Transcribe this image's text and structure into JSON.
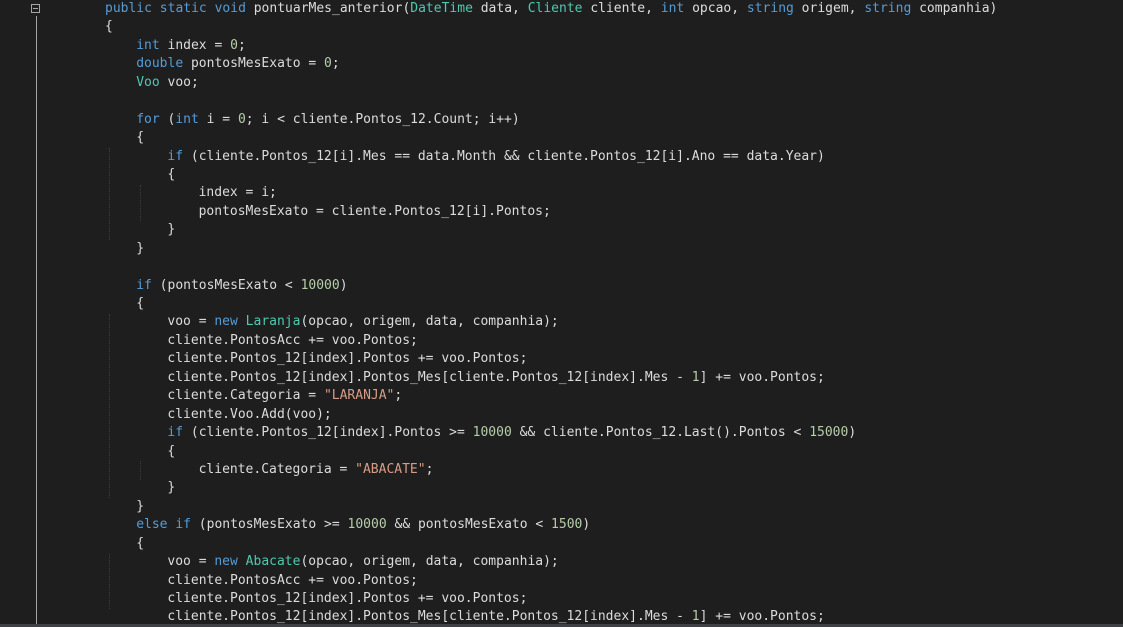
{
  "colors": {
    "background": "#1e1e1e",
    "plain": "#dcdcdc",
    "keyword": "#569cd6",
    "type": "#4ec9b0",
    "number": "#b5cea8",
    "string": "#d69d85"
  },
  "editor": {
    "lines": [
      {
        "indent": 0,
        "tokens": [
          [
            "public",
            "keyword"
          ],
          [
            " ",
            "plain"
          ],
          [
            "static",
            "keyword"
          ],
          [
            " ",
            "plain"
          ],
          [
            "void",
            "keyword"
          ],
          [
            " pontuarMes_anterior(",
            "plain"
          ],
          [
            "DateTime",
            "type"
          ],
          [
            " data, ",
            "plain"
          ],
          [
            "Cliente",
            "type"
          ],
          [
            " cliente, ",
            "plain"
          ],
          [
            "int",
            "keyword"
          ],
          [
            " opcao, ",
            "plain"
          ],
          [
            "string",
            "keyword"
          ],
          [
            " origem, ",
            "plain"
          ],
          [
            "string",
            "keyword"
          ],
          [
            " companhia)",
            "plain"
          ]
        ]
      },
      {
        "indent": 0,
        "tokens": [
          [
            "{",
            "plain"
          ]
        ]
      },
      {
        "indent": 1,
        "tokens": [
          [
            "int",
            "keyword"
          ],
          [
            " index = ",
            "plain"
          ],
          [
            "0",
            "number"
          ],
          [
            ";",
            "plain"
          ]
        ]
      },
      {
        "indent": 1,
        "tokens": [
          [
            "double",
            "keyword"
          ],
          [
            " pontosMesExato = ",
            "plain"
          ],
          [
            "0",
            "number"
          ],
          [
            ";",
            "plain"
          ]
        ]
      },
      {
        "indent": 1,
        "tokens": [
          [
            "Voo",
            "type"
          ],
          [
            " voo;",
            "plain"
          ]
        ]
      },
      {
        "indent": 0,
        "tokens": []
      },
      {
        "indent": 1,
        "tokens": [
          [
            "for",
            "keyword"
          ],
          [
            " (",
            "plain"
          ],
          [
            "int",
            "keyword"
          ],
          [
            " i = ",
            "plain"
          ],
          [
            "0",
            "number"
          ],
          [
            "; i < cliente.Pontos_12.Count; i++)",
            "plain"
          ]
        ]
      },
      {
        "indent": 1,
        "tokens": [
          [
            "{",
            "plain"
          ]
        ]
      },
      {
        "indent": 2,
        "tokens": [
          [
            "if",
            "keyword"
          ],
          [
            " (cliente.Pontos_12[i].Mes == data.Month && cliente.Pontos_12[i].Ano == data.Year)",
            "plain"
          ]
        ]
      },
      {
        "indent": 2,
        "tokens": [
          [
            "{",
            "plain"
          ]
        ]
      },
      {
        "indent": 3,
        "tokens": [
          [
            "index = i;",
            "plain"
          ]
        ]
      },
      {
        "indent": 3,
        "tokens": [
          [
            "pontosMesExato = cliente.Pontos_12[i].Pontos;",
            "plain"
          ]
        ]
      },
      {
        "indent": 2,
        "tokens": [
          [
            "}",
            "plain"
          ]
        ]
      },
      {
        "indent": 1,
        "tokens": [
          [
            "}",
            "plain"
          ]
        ]
      },
      {
        "indent": 0,
        "tokens": []
      },
      {
        "indent": 1,
        "tokens": [
          [
            "if",
            "keyword"
          ],
          [
            " (pontosMesExato < ",
            "plain"
          ],
          [
            "10000",
            "number"
          ],
          [
            ")",
            "plain"
          ]
        ]
      },
      {
        "indent": 1,
        "tokens": [
          [
            "{",
            "plain"
          ]
        ]
      },
      {
        "indent": 2,
        "tokens": [
          [
            "voo = ",
            "plain"
          ],
          [
            "new",
            "keyword"
          ],
          [
            " ",
            "plain"
          ],
          [
            "Laranja",
            "type"
          ],
          [
            "(opcao, origem, data, companhia);",
            "plain"
          ]
        ]
      },
      {
        "indent": 2,
        "tokens": [
          [
            "cliente.PontosAcc += voo.Pontos;",
            "plain"
          ]
        ]
      },
      {
        "indent": 2,
        "tokens": [
          [
            "cliente.Pontos_12[index].Pontos += voo.Pontos;",
            "plain"
          ]
        ]
      },
      {
        "indent": 2,
        "tokens": [
          [
            "cliente.Pontos_12[index].Pontos_Mes[cliente.Pontos_12[index].Mes - ",
            "plain"
          ],
          [
            "1",
            "number"
          ],
          [
            "] += voo.Pontos;",
            "plain"
          ]
        ]
      },
      {
        "indent": 2,
        "tokens": [
          [
            "cliente.Categoria = ",
            "plain"
          ],
          [
            "\"LARANJA\"",
            "string"
          ],
          [
            ";",
            "plain"
          ]
        ]
      },
      {
        "indent": 2,
        "tokens": [
          [
            "cliente.Voo.Add(voo);",
            "plain"
          ]
        ]
      },
      {
        "indent": 2,
        "tokens": [
          [
            "if",
            "keyword"
          ],
          [
            " (cliente.Pontos_12[index].Pontos >= ",
            "plain"
          ],
          [
            "10000",
            "number"
          ],
          [
            " && cliente.Pontos_12.Last().Pontos < ",
            "plain"
          ],
          [
            "15000",
            "number"
          ],
          [
            ")",
            "plain"
          ]
        ]
      },
      {
        "indent": 2,
        "tokens": [
          [
            "{",
            "plain"
          ]
        ]
      },
      {
        "indent": 3,
        "tokens": [
          [
            "cliente.Categoria = ",
            "plain"
          ],
          [
            "\"ABACATE\"",
            "string"
          ],
          [
            ";",
            "plain"
          ]
        ]
      },
      {
        "indent": 2,
        "tokens": [
          [
            "}",
            "plain"
          ]
        ]
      },
      {
        "indent": 1,
        "tokens": [
          [
            "}",
            "plain"
          ]
        ]
      },
      {
        "indent": 1,
        "tokens": [
          [
            "else",
            "keyword"
          ],
          [
            " ",
            "plain"
          ],
          [
            "if",
            "keyword"
          ],
          [
            " (pontosMesExato >= ",
            "plain"
          ],
          [
            "10000",
            "number"
          ],
          [
            " && pontosMesExato < ",
            "plain"
          ],
          [
            "1500",
            "number"
          ],
          [
            ")",
            "plain"
          ]
        ]
      },
      {
        "indent": 1,
        "tokens": [
          [
            "{",
            "plain"
          ]
        ]
      },
      {
        "indent": 2,
        "tokens": [
          [
            "voo = ",
            "plain"
          ],
          [
            "new",
            "keyword"
          ],
          [
            " ",
            "plain"
          ],
          [
            "Abacate",
            "type"
          ],
          [
            "(opcao, origem, data, companhia);",
            "plain"
          ]
        ]
      },
      {
        "indent": 2,
        "tokens": [
          [
            "cliente.PontosAcc += voo.Pontos;",
            "plain"
          ]
        ]
      },
      {
        "indent": 2,
        "tokens": [
          [
            "cliente.Pontos_12[index].Pontos += voo.Pontos;",
            "plain"
          ]
        ]
      },
      {
        "indent": 2,
        "tokens": [
          [
            "cliente.Pontos_12[index].Pontos_Mes[cliente.Pontos_12[index].Mes - ",
            "plain"
          ],
          [
            "1",
            "number"
          ],
          [
            "] += voo.Pontos;",
            "plain"
          ]
        ]
      }
    ]
  }
}
